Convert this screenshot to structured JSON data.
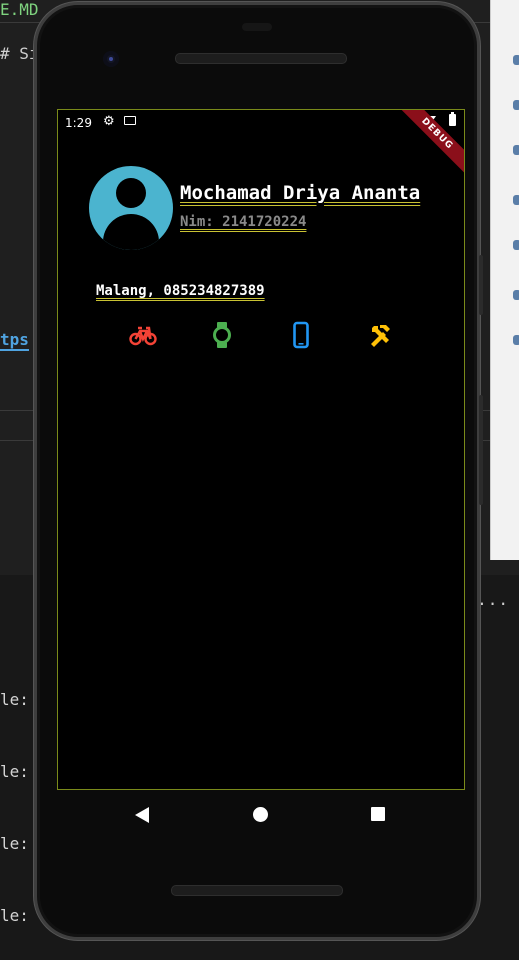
{
  "editor": {
    "tab_fragment": "E.MD",
    "heading_fragment": "# Si",
    "link_fragment": "tps",
    "code_lines": [
      "le:",
      "le:",
      "le:",
      "le:"
    ],
    "more_dots": "..."
  },
  "status_bar": {
    "time": "1:29"
  },
  "debug_banner": "DEBUG",
  "profile": {
    "name": "Mochamad Driya Ananta",
    "nim": "Nim: 2141720224",
    "contact": "Malang, 085234827389"
  },
  "hobby_icons": [
    {
      "name": "bike-icon",
      "color": "#f44336"
    },
    {
      "name": "watch-icon",
      "color": "#4caf50"
    },
    {
      "name": "phone-android-icon",
      "color": "#2196f3"
    },
    {
      "name": "handyman-icon",
      "color": "#ffc107"
    }
  ],
  "colors": {
    "avatar_bg": "#4bb4cf",
    "underline": "#c9c233",
    "screen_border": "#7a8a1a"
  }
}
